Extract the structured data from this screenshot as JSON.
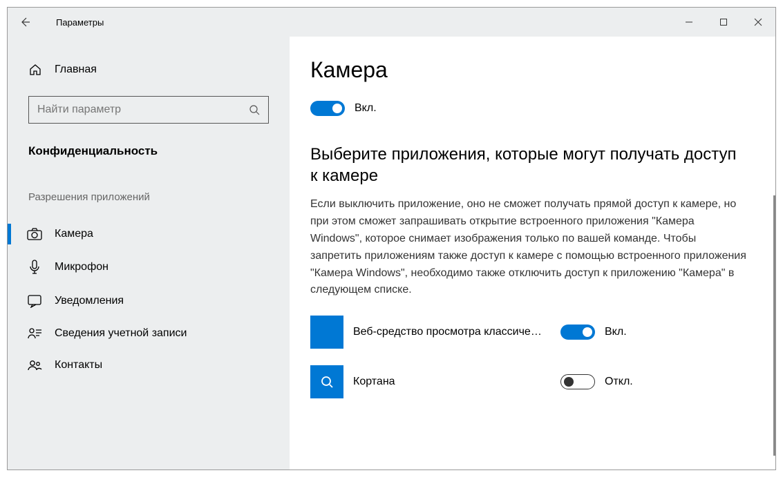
{
  "titlebar": {
    "title": "Параметры"
  },
  "sidebar": {
    "home": "Главная",
    "search_placeholder": "Найти параметр",
    "category": "Конфиденциальность",
    "section": "Разрешения приложений",
    "items": [
      {
        "label": "Камера",
        "icon": "camera",
        "selected": true
      },
      {
        "label": "Микрофон",
        "icon": "microphone",
        "selected": false
      },
      {
        "label": "Уведомления",
        "icon": "notifications",
        "selected": false
      },
      {
        "label": "Сведения учетной записи",
        "icon": "account",
        "selected": false
      },
      {
        "label": "Контакты",
        "icon": "contacts",
        "selected": false
      }
    ]
  },
  "content": {
    "heading": "Камера",
    "main_toggle": {
      "state": "on",
      "label": "Вкл."
    },
    "sub_heading": "Выберите приложения, которые могут получать доступ к камере",
    "description": "Если выключить приложение, оно не сможет получать прямой доступ к камере, но при этом сможет запрашивать открытие встроенного приложения \"Камера Windows\", которое снимает изображения только по вашей команде. Чтобы запретить приложениям также доступ к камере с помощью встроенного приложения \"Камера Windows\", необходимо также отключить доступ к приложению \"Камера\" в следующем списке.",
    "apps": [
      {
        "name": "Веб-средство просмотра классиче…",
        "icon": "blank",
        "state": "on",
        "state_label": "Вкл."
      },
      {
        "name": "Кортана",
        "icon": "search",
        "state": "off",
        "state_label": "Откл."
      }
    ]
  }
}
